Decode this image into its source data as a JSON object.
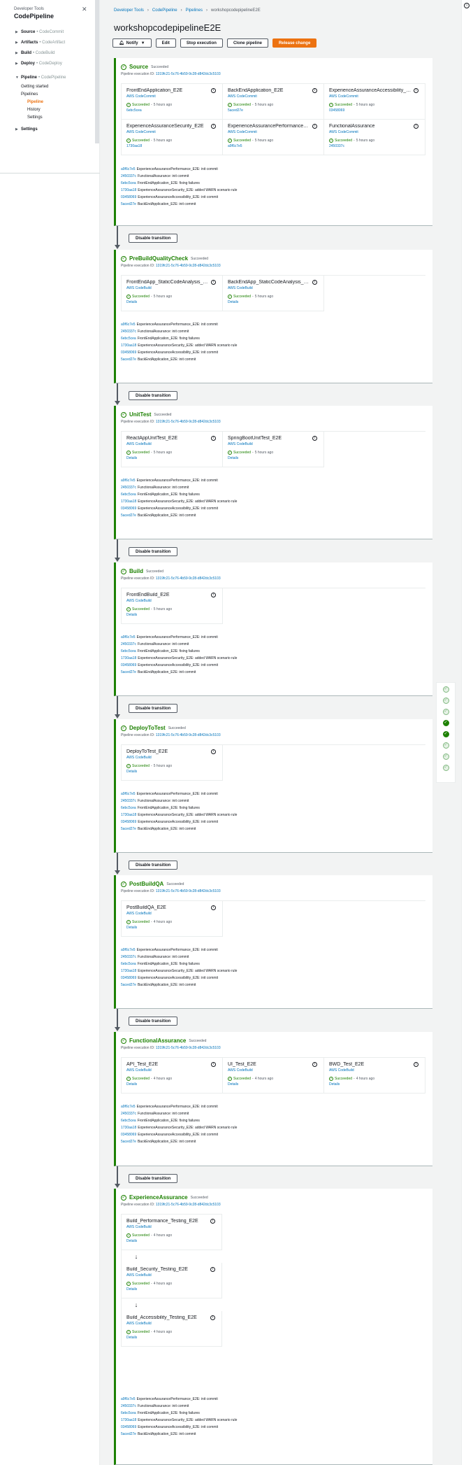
{
  "sidebar": {
    "service": "Developer Tools",
    "title": "CodePipeline",
    "sections": [
      {
        "name": "Source",
        "sub": "CodeCommit"
      },
      {
        "name": "Artifacts",
        "sub": "CodeArtifact"
      },
      {
        "name": "Build",
        "sub": "CodeBuild"
      },
      {
        "name": "Deploy",
        "sub": "CodeDeploy"
      }
    ],
    "pipeline_section": {
      "name": "Pipeline",
      "sub": "CodePipeline"
    },
    "items": [
      "Getting started",
      "Pipelines"
    ],
    "subitems": [
      "Pipeline",
      "History",
      "Settings"
    ],
    "settings": "Settings"
  },
  "breadcrumb": [
    "Developer Tools",
    "CodePipeline",
    "Pipelines",
    "workshopcodepipelineE2E"
  ],
  "page_title": "workshopcodepipelineE2E",
  "toolbar": {
    "notify": "Notify",
    "edit": "Edit",
    "stop": "Stop execution",
    "clone": "Clone pipeline",
    "release": "Release change"
  },
  "exec_label": "Pipeline execution ID:",
  "exec_id": "1319fc21-5c76-4b59-9c28-d842dc3c5103",
  "succeeded": "Succeeded",
  "details": "Details",
  "disable_transition": "Disable transition",
  "commits": [
    {
      "id": "a9f6c7e5",
      "msg": "ExperienceAssurancePerformance_E2E: init commit"
    },
    {
      "id": "2450337c",
      "msg": "FunctionalAssurance: init commit"
    },
    {
      "id": "6ebc5cea",
      "msg": "FrontEndApplication_E2E: fixing failures"
    },
    {
      "id": "1730aa18",
      "msg": "ExperienceAssuranceSecurity_E2E: added WARN scenario rule"
    },
    {
      "id": "03458069",
      "msg": "ExperienceAssuranceAccessibility_E2E: init commit"
    },
    {
      "id": "5aced27e",
      "msg": "BackEndApplication_E2E: init commit"
    }
  ],
  "stages": [
    {
      "name": "Source",
      "status": "Succeeded",
      "actions": [
        {
          "name": "FrontEndApplication_E2E",
          "provider": "AWS CodeCommit",
          "ago": "5 hours ago",
          "link": "6ebc5cea"
        },
        {
          "name": "BackEndApplication_E2E",
          "provider": "AWS CodeCommit",
          "ago": "5 hours ago",
          "link": "5aced27e"
        },
        {
          "name": "ExperienceAssuranceAccessibility_E2E",
          "provider": "AWS CodeCommit",
          "ago": "5 hours ago",
          "link": "03458069"
        },
        {
          "name": "ExperienceAssuranceSecurity_E2E",
          "provider": "AWS CodeCommit",
          "ago": "5 hours ago",
          "link": "1730aa18"
        },
        {
          "name": "ExperienceAssurancePerformance_E2E",
          "provider": "AWS CodeCommit",
          "ago": "5 hours ago",
          "link": "a9f6c7e5"
        },
        {
          "name": "FunctionalAssurance",
          "provider": "AWS CodeCommit",
          "ago": "5 hours ago",
          "link": "2450337c"
        }
      ]
    },
    {
      "name": "PreBuildQualityCheck",
      "status": "Succeeded",
      "actions": [
        {
          "name": "FrontEndApp_StaticCodeAnalysis_E2E",
          "provider": "AWS CodeBuild",
          "ago": "5 hours ago",
          "link": "Details"
        },
        {
          "name": "BackEndApp_StaticCodeAnalysis_E2E",
          "provider": "AWS CodeBuild",
          "ago": "5 hours ago",
          "link": "Details"
        }
      ]
    },
    {
      "name": "UnitTest",
      "status": "Succeeded",
      "actions": [
        {
          "name": "ReactAppUnitTest_E2E",
          "provider": "AWS CodeBuild",
          "ago": "5 hours ago",
          "link": "Details"
        },
        {
          "name": "SpringBootUnitTest_E2E",
          "provider": "AWS CodeBuild",
          "ago": "5 hours ago",
          "link": "Details"
        }
      ]
    },
    {
      "name": "Build",
      "status": "Succeeded",
      "actions": [
        {
          "name": "FrontEndBuild_E2E",
          "provider": "AWS CodeBuild",
          "ago": "5 hours ago",
          "link": "Details"
        }
      ]
    },
    {
      "name": "DeployToTest",
      "status": "Succeeded",
      "actions": [
        {
          "name": "DeployToTest_E2E",
          "provider": "AWS CodeBuild",
          "ago": "5 hours ago",
          "link": "Details"
        }
      ]
    },
    {
      "name": "PostBuildQA",
      "status": "Succeeded",
      "actions": [
        {
          "name": "PostBuildQA_E2E",
          "provider": "AWS CodeBuild",
          "ago": "4 hours ago",
          "link": "Details"
        }
      ]
    },
    {
      "name": "FunctionalAssurance",
      "status": "Succeeded",
      "actions": [
        {
          "name": "API_Test_E2E",
          "provider": "AWS CodeBuild",
          "ago": "4 hours ago",
          "link": "Details"
        },
        {
          "name": "UI_Test_E2E",
          "provider": "AWS CodeBuild",
          "ago": "4 hours ago",
          "link": "Details"
        },
        {
          "name": "BWD_Test_E2E",
          "provider": "AWS CodeBuild",
          "ago": "4 hours ago",
          "link": "Details"
        }
      ]
    },
    {
      "name": "ExperienceAssurance",
      "status": "Succeeded",
      "actions": [
        {
          "name": "Build_Performance_Testing_E2E",
          "provider": "AWS CodeBuild",
          "ago": "4 hours ago",
          "link": "Details"
        },
        {
          "name": "Build_Security_Testing_E2E",
          "provider": "AWS CodeBuild",
          "ago": "4 hours ago",
          "link": "Details"
        },
        {
          "name": "Build_Accessibility_Testing_E2E",
          "provider": "AWS CodeBuild",
          "ago": "4 hours ago",
          "link": "Details"
        }
      ]
    }
  ],
  "colors": {
    "success": "#1d8102",
    "accent": "#ec7211",
    "link": "#0073bb"
  }
}
